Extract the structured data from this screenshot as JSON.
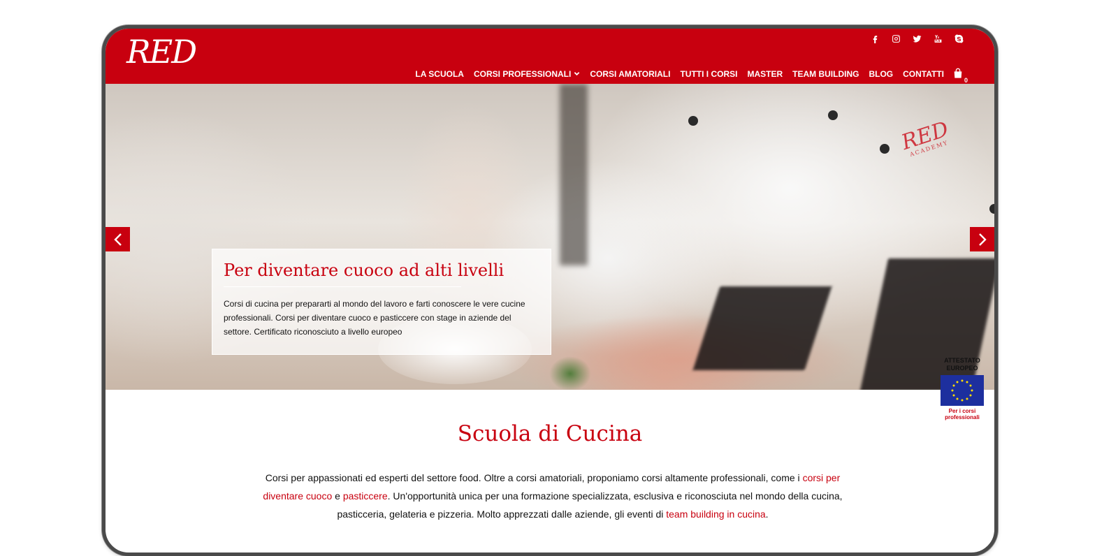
{
  "brand": {
    "logo_text": "RED",
    "accent_color": "#c8000f"
  },
  "social": [
    {
      "icon": "facebook-icon"
    },
    {
      "icon": "instagram-icon"
    },
    {
      "icon": "twitter-icon"
    },
    {
      "icon": "youtube-icon"
    },
    {
      "icon": "skype-icon"
    }
  ],
  "nav": {
    "items": [
      {
        "label": "LA SCUOLA"
      },
      {
        "label": "CORSI PROFESSIONALI"
      },
      {
        "label": "CORSI AMATORIALI"
      },
      {
        "label": "TUTTI I CORSI"
      },
      {
        "label": "MASTER"
      },
      {
        "label": "TEAM BUILDING"
      },
      {
        "label": "BLOG"
      },
      {
        "label": "CONTATTI"
      }
    ],
    "cart_count": "0"
  },
  "hero": {
    "coat_logo": "RED",
    "coat_logo_sub": "ACADEMY",
    "caption_title": "Per diventare cuoco ad alti livelli",
    "caption_text": "Corsi di cucina per prepararti al mondo del lavoro e farti conoscere le vere cucine professionali. Corsi per diventare cuoco e pasticcere con stage in aziende del settore. Certificato riconosciuto a livello europeo"
  },
  "eu_badge": {
    "top_line1": "ATTESTATO",
    "top_line2": "EUROPEO",
    "bottom_line1": "Per i corsi",
    "bottom_line2": "professionali"
  },
  "main": {
    "heading": "Scuola di Cucina",
    "intro_part1": "Corsi per appassionati ed esperti del settore food. Oltre a corsi amatoriali, proponiamo corsi altamente professionali, come i ",
    "link_cuoco": "corsi per diventare cuoco",
    "intro_part2": " e ",
    "link_pasticcere": "pasticcere",
    "intro_part3": ". Un'opportunità unica per una formazione specializzata, esclusiva e riconosciuta nel mondo della cucina, pasticceria, gelateria e pizzeria. Molto apprezzati dalle aziende, gli eventi di ",
    "link_team": "team building in cucina",
    "intro_part4": "."
  }
}
